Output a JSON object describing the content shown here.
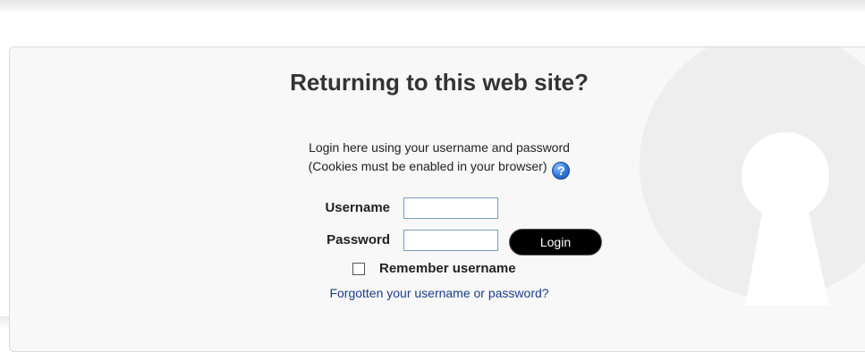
{
  "login": {
    "title": "Returning to this web site?",
    "description_line1": "Login here using your username and password",
    "description_line2": "(Cookies must be enabled in your browser)",
    "help_icon_glyph": "?",
    "username_label": "Username",
    "username_value": "",
    "password_label": "Password",
    "password_value": "",
    "login_button": "Login",
    "remember_label": "Remember username",
    "remember_checked": false,
    "forgot_link": "Forgotten your username or password?"
  },
  "colors": {
    "link": "#1a3c8a",
    "button_bg": "#000000",
    "panel_bg": "#f8f8f8",
    "help_icon": "#2f75d8"
  },
  "icons": {
    "help": "help-icon",
    "decor": "keyhole-icon"
  }
}
